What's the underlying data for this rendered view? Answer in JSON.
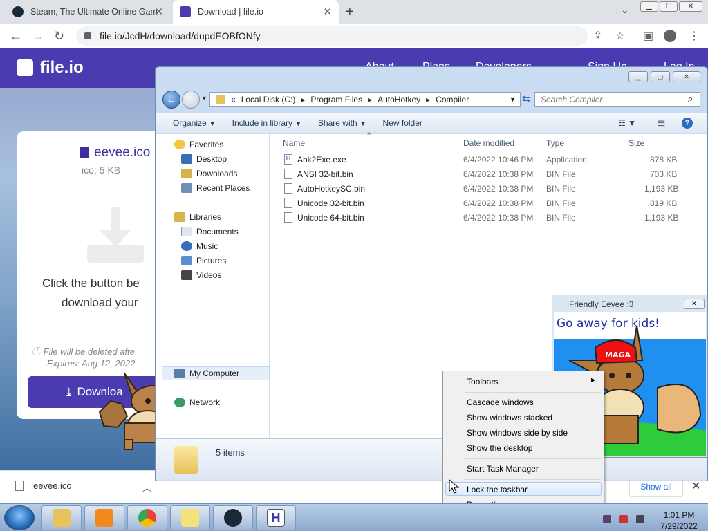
{
  "browser": {
    "tabs": [
      {
        "label": "Steam, The Ultimate Online Gam",
        "icon": "steam-icon"
      },
      {
        "label": "Download | file.io",
        "icon": "fileio-icon"
      }
    ],
    "url": "file.io/JcdH/download/dupdEOBfONfy"
  },
  "fileio": {
    "logo": "file.io",
    "nav_partial": [
      "About",
      "Plans",
      "Developers",
      "Sign Up",
      "Log In"
    ],
    "filename": "eevee.ico",
    "filemeta": "ico; 5 KB",
    "click_line1": "Click the button be",
    "click_line2": "download your",
    "deleted_line": "File will be deleted afte",
    "expires_line": "Expires: Aug 12, 2022",
    "download_label": "Downloa"
  },
  "shelf": {
    "filename": "eevee.ico",
    "show_all": "Show all"
  },
  "explorer": {
    "breadcrumb": [
      "Local Disk (C:)",
      "Program Files",
      "AutoHotkey",
      "Compiler"
    ],
    "search_placeholder": "Search Compiler",
    "commands": [
      "Organize",
      "Include in library",
      "Share with",
      "New folder"
    ],
    "nav": {
      "favorites": "Favorites",
      "fav_items": [
        "Desktop",
        "Downloads",
        "Recent Places"
      ],
      "libraries": "Libraries",
      "lib_items": [
        "Documents",
        "Music",
        "Pictures",
        "Videos"
      ],
      "computer": "My Computer",
      "network": "Network"
    },
    "columns": [
      "Name",
      "Date modified",
      "Type",
      "Size"
    ],
    "files": [
      {
        "name": "Ahk2Exe.exe",
        "date": "6/4/2022 10:46 PM",
        "type": "Application",
        "size": "878 KB"
      },
      {
        "name": "ANSI 32-bit.bin",
        "date": "6/4/2022 10:38 PM",
        "type": "BIN File",
        "size": "703 KB"
      },
      {
        "name": "AutoHotkeySC.bin",
        "date": "6/4/2022 10:38 PM",
        "type": "BIN File",
        "size": "1,193 KB"
      },
      {
        "name": "Unicode 32-bit.bin",
        "date": "6/4/2022 10:38 PM",
        "type": "BIN File",
        "size": "819 KB"
      },
      {
        "name": "Unicode 64-bit.bin",
        "date": "6/4/2022 10:38 PM",
        "type": "BIN File",
        "size": "1,193 KB"
      }
    ],
    "status": "5 items"
  },
  "eevee_window": {
    "title": "Friendly Eevee :3",
    "drawing_text": "Go away for kids!",
    "hat_text": "MAGA"
  },
  "context_menu": {
    "toolbars": "Toolbars",
    "cascade": "Cascade windows",
    "stacked": "Show windows stacked",
    "side_by_side": "Show windows side by side",
    "show_desktop": "Show the desktop",
    "task_manager": "Start Task Manager",
    "lock": "Lock the taskbar",
    "properties": "Properties"
  },
  "taskbar": {
    "time": "1:01 PM",
    "date": "7/29/2022"
  },
  "colors": {
    "fileio_brand": "#4b3bb0",
    "win7_selection": "#dcebfc"
  }
}
